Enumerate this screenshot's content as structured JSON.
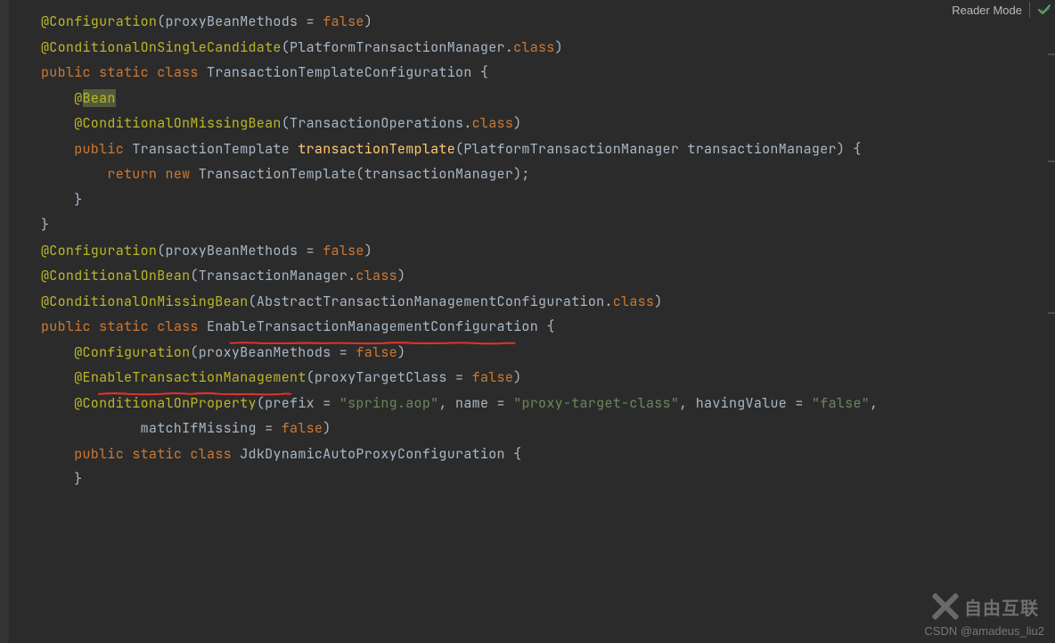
{
  "toolbar": {
    "reader_mode_label": "Reader Mode"
  },
  "watermark": {
    "bottom_text": "CSDN @amadeus_liu2",
    "logo_text": "自由互联"
  },
  "code": {
    "lines": [
      {
        "tokens": [
          {
            "t": "ann",
            "s": "@Configuration"
          },
          {
            "t": "op",
            "s": "(proxyBeanMethods = "
          },
          {
            "t": "kw",
            "s": "false"
          },
          {
            "t": "op",
            "s": ")"
          }
        ]
      },
      {
        "tokens": [
          {
            "t": "ann",
            "s": "@ConditionalOnSingleCandidate"
          },
          {
            "t": "op",
            "s": "(PlatformTransactionManager."
          },
          {
            "t": "kw",
            "s": "class"
          },
          {
            "t": "op",
            "s": ")"
          }
        ]
      },
      {
        "tokens": [
          {
            "t": "kw",
            "s": "public "
          },
          {
            "t": "kw",
            "s": "static "
          },
          {
            "t": "kw",
            "s": "class "
          },
          {
            "t": "cls",
            "s": "TransactionTemplateConfiguration {"
          }
        ]
      },
      {
        "tokens": []
      },
      {
        "indent": 1,
        "tokens": [
          {
            "t": "ann",
            "s": "@"
          },
          {
            "t": "ann",
            "s": "Bean",
            "hl": true
          }
        ]
      },
      {
        "indent": 1,
        "tokens": [
          {
            "t": "ann",
            "s": "@ConditionalOnMissingBean"
          },
          {
            "t": "op",
            "s": "(TransactionOperations."
          },
          {
            "t": "kw",
            "s": "class"
          },
          {
            "t": "op",
            "s": ")"
          }
        ]
      },
      {
        "indent": 1,
        "tokens": [
          {
            "t": "kw",
            "s": "public "
          },
          {
            "t": "cls",
            "s": "TransactionTemplate "
          },
          {
            "t": "fn",
            "s": "transactionTemplate"
          },
          {
            "t": "op",
            "s": "(PlatformTransactionManager transactionManager) {"
          }
        ]
      },
      {
        "indent": 2,
        "tokens": [
          {
            "t": "kw",
            "s": "return "
          },
          {
            "t": "kw",
            "s": "new "
          },
          {
            "t": "cls",
            "s": "TransactionTemplate(transactionManager)"
          },
          {
            "t": "op",
            "s": ";"
          }
        ]
      },
      {
        "indent": 1,
        "tokens": [
          {
            "t": "op",
            "s": "}"
          }
        ]
      },
      {
        "tokens": []
      },
      {
        "tokens": [
          {
            "t": "op",
            "s": "}"
          }
        ]
      },
      {
        "tokens": []
      },
      {
        "tokens": [
          {
            "t": "ann",
            "s": "@Configuration"
          },
          {
            "t": "op",
            "s": "(proxyBeanMethods = "
          },
          {
            "t": "kw",
            "s": "false"
          },
          {
            "t": "op",
            "s": ")"
          }
        ]
      },
      {
        "tokens": [
          {
            "t": "ann",
            "s": "@ConditionalOnBean"
          },
          {
            "t": "op",
            "s": "(TransactionManager."
          },
          {
            "t": "kw",
            "s": "class"
          },
          {
            "t": "op",
            "s": ")"
          }
        ]
      },
      {
        "tokens": [
          {
            "t": "ann",
            "s": "@ConditionalOnMissingBean"
          },
          {
            "t": "op",
            "s": "(AbstractTransactionManagementConfiguration."
          },
          {
            "t": "kw",
            "s": "class"
          },
          {
            "t": "op",
            "s": ")"
          }
        ]
      },
      {
        "tokens": [
          {
            "t": "kw",
            "s": "public "
          },
          {
            "t": "kw",
            "s": "static "
          },
          {
            "t": "kw",
            "s": "class "
          },
          {
            "t": "cls",
            "s": "EnableTransactionManagementConfiguration",
            "red": true
          },
          {
            "t": "op",
            "s": " {"
          }
        ]
      },
      {
        "tokens": []
      },
      {
        "indent": 1,
        "tokens": [
          {
            "t": "ann",
            "s": "@Configuration"
          },
          {
            "t": "op",
            "s": "(proxyBeanMethods = "
          },
          {
            "t": "kw",
            "s": "false"
          },
          {
            "t": "op",
            "s": ")"
          }
        ]
      },
      {
        "indent": 1,
        "tokens": [
          {
            "t": "ann",
            "s": "@"
          },
          {
            "t": "ann",
            "s": "EnableTransactionManagement",
            "red": true
          },
          {
            "t": "op",
            "s": "(proxyTargetClass = "
          },
          {
            "t": "kw",
            "s": "false"
          },
          {
            "t": "op",
            "s": ")"
          }
        ]
      },
      {
        "indent": 1,
        "tokens": [
          {
            "t": "ann",
            "s": "@ConditionalOnProperty"
          },
          {
            "t": "op",
            "s": "(prefix = "
          },
          {
            "t": "str",
            "s": "\"spring.aop\""
          },
          {
            "t": "op",
            "s": ", name = "
          },
          {
            "t": "str",
            "s": "\"proxy-target-class\""
          },
          {
            "t": "op",
            "s": ", havingValue = "
          },
          {
            "t": "str",
            "s": "\"false\""
          },
          {
            "t": "op",
            "s": ","
          }
        ]
      },
      {
        "indent": 3,
        "tokens": [
          {
            "t": "op",
            "s": "matchIfMissing = "
          },
          {
            "t": "kw",
            "s": "false"
          },
          {
            "t": "op",
            "s": ")"
          }
        ]
      },
      {
        "indent": 1,
        "tokens": [
          {
            "t": "kw",
            "s": "public "
          },
          {
            "t": "kw",
            "s": "static "
          },
          {
            "t": "kw",
            "s": "class "
          },
          {
            "t": "cls",
            "s": "JdkDynamicAutoProxyConfiguration {"
          }
        ]
      },
      {
        "tokens": []
      },
      {
        "indent": 1,
        "tokens": [
          {
            "t": "op",
            "s": "}"
          }
        ]
      }
    ]
  },
  "markers": [
    60,
    180,
    350
  ]
}
